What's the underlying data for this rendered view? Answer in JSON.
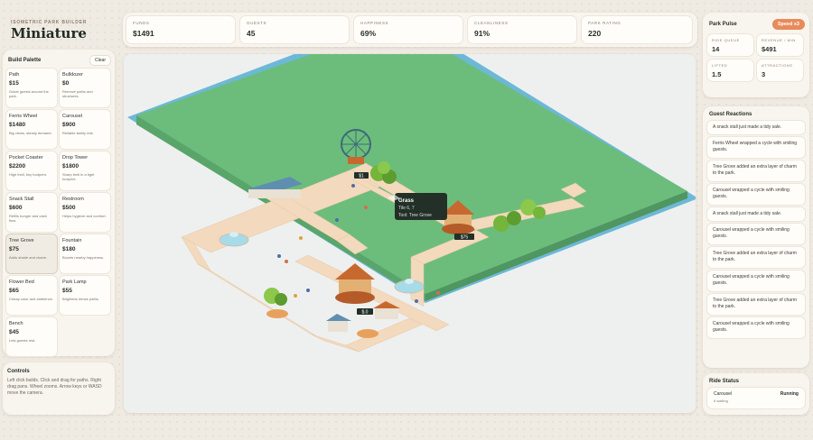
{
  "brand": {
    "subtitle": "ISOMETRIC PARK BUILDER",
    "title": "Miniature"
  },
  "palette": {
    "title": "Build Palette",
    "clear_label": "Clear",
    "items": [
      {
        "name": "Path",
        "price": "$15",
        "desc": "Guide guests around the park."
      },
      {
        "name": "Bulldozer",
        "price": "$0",
        "desc": "Remove paths and structures."
      },
      {
        "name": "Ferris Wheel",
        "price": "$1480",
        "desc": "Big views, steady demand."
      },
      {
        "name": "Carousel",
        "price": "$900",
        "desc": "Reliable family ride."
      },
      {
        "name": "Pocket Coaster",
        "price": "$2200",
        "desc": "High thrill, tiny footprint."
      },
      {
        "name": "Drop Tower",
        "price": "$1800",
        "desc": "Sharp thrill in a tight footprint."
      },
      {
        "name": "Snack Stall",
        "price": "$600",
        "desc": "Refills hunger and cash flow."
      },
      {
        "name": "Restroom",
        "price": "$500",
        "desc": "Helps hygiene and comfort."
      },
      {
        "name": "Tree Grove",
        "price": "$75",
        "desc": "Adds shade and charm."
      },
      {
        "name": "Fountain",
        "price": "$180",
        "desc": "Boosts nearby happiness."
      },
      {
        "name": "Flower Bed",
        "price": "$65",
        "desc": "Cheap color and ambience."
      },
      {
        "name": "Park Lamp",
        "price": "$55",
        "desc": "Brightens dense paths."
      },
      {
        "name": "Bench",
        "price": "$45",
        "desc": "Lets guests rest."
      }
    ]
  },
  "controls": {
    "title": "Controls",
    "text": "Left click builds. Click and drag for paths. Right drag pans. Wheel zooms. Arrow keys or WASD move the camera."
  },
  "stats": [
    {
      "label": "FUNDS",
      "value": "$1491"
    },
    {
      "label": "GUESTS",
      "value": "45"
    },
    {
      "label": "HAPPINESS",
      "value": "69%"
    },
    {
      "label": "CLEANLINESS",
      "value": "91%"
    },
    {
      "label": "PARK RATING",
      "value": "220"
    }
  ],
  "map": {
    "tooltip": {
      "title": "Grass",
      "tile": "Tile 6, 7",
      "tool": "Tool: Tree Grove"
    },
    "ride_labels": [
      "$1",
      "$.0",
      "$75"
    ],
    "colors": {
      "water": "#6db8d6",
      "grass": "#6cbd7c",
      "path": "#f3d9bd",
      "accent": "#c7692f"
    }
  },
  "pulse": {
    "title": "Park Pulse",
    "speed_label": "Speed x3",
    "cells": [
      {
        "label": "RIDE QUEUE",
        "value": "14"
      },
      {
        "label": "REVENUE / MIN",
        "value": "$491"
      },
      {
        "label": "LIFTED",
        "value": "1.5"
      },
      {
        "label": "ATTRACTIONS",
        "value": "3"
      }
    ]
  },
  "reactions": {
    "title": "Guest Reactions",
    "items": [
      "A snack stall just made a tidy sale.",
      "Ferris Wheel wrapped a cycle with smiling guests.",
      "Tree Grove added an extra layer of charm to the park.",
      "Carousel wrapped a cycle with smiling guests.",
      "A snack stall just made a tidy sale.",
      "Carousel wrapped a cycle with smiling guests.",
      "Tree Grove added an extra layer of charm to the park.",
      "Carousel wrapped a cycle with smiling guests.",
      "Tree Grove added an extra layer of charm to the park.",
      "Carousel wrapped a cycle with smiling guests."
    ]
  },
  "ride_status": {
    "title": "Ride Status",
    "ride": "Carousel",
    "state": "Running",
    "sub": "6 waiting"
  }
}
